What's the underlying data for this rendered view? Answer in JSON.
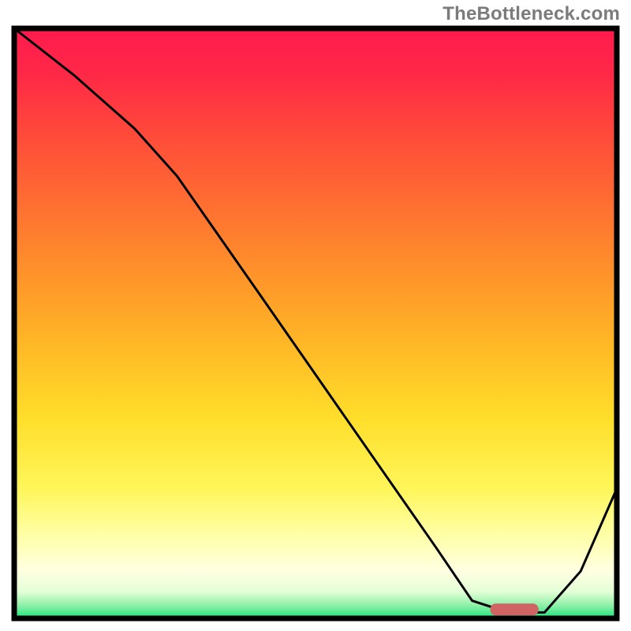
{
  "watermark": "TheBottleneck.com",
  "colors": {
    "frame": "#000000",
    "curve": "#000000",
    "marker": "#d06363",
    "gradient_stops": [
      {
        "offset": 0.0,
        "color": "#ff1a4e"
      },
      {
        "offset": 0.08,
        "color": "#ff2946"
      },
      {
        "offset": 0.18,
        "color": "#ff4a3a"
      },
      {
        "offset": 0.3,
        "color": "#ff6f31"
      },
      {
        "offset": 0.42,
        "color": "#ff942a"
      },
      {
        "offset": 0.54,
        "color": "#ffb926"
      },
      {
        "offset": 0.66,
        "color": "#ffde2a"
      },
      {
        "offset": 0.78,
        "color": "#fff65a"
      },
      {
        "offset": 0.86,
        "color": "#ffffa8"
      },
      {
        "offset": 0.92,
        "color": "#ffffe2"
      },
      {
        "offset": 0.955,
        "color": "#e3ffd6"
      },
      {
        "offset": 0.978,
        "color": "#8ef0a8"
      },
      {
        "offset": 1.0,
        "color": "#19e57a"
      }
    ]
  },
  "chart_data": {
    "type": "line",
    "title": "",
    "xlabel": "",
    "ylabel": "",
    "xlim": [
      0,
      100
    ],
    "ylim": [
      0,
      100
    ],
    "grid": false,
    "legend": false,
    "note": "x/y are percentages of the inner plot area; y=0 is the bottom (green) and y=100 is the top (red). The drawn curve follows these points.",
    "series": [
      {
        "name": "bottleneck-curve",
        "x": [
          0,
          10,
          20,
          27,
          40,
          55,
          70,
          76,
          82,
          88,
          94,
          100
        ],
        "y": [
          100,
          92,
          83,
          75,
          56,
          34,
          12,
          3,
          1,
          1,
          8,
          22
        ]
      }
    ],
    "marker": {
      "name": "optimal-zone-marker",
      "x_start": 79,
      "x_end": 87,
      "y": 1.5,
      "shape": "rounded-bar"
    }
  }
}
